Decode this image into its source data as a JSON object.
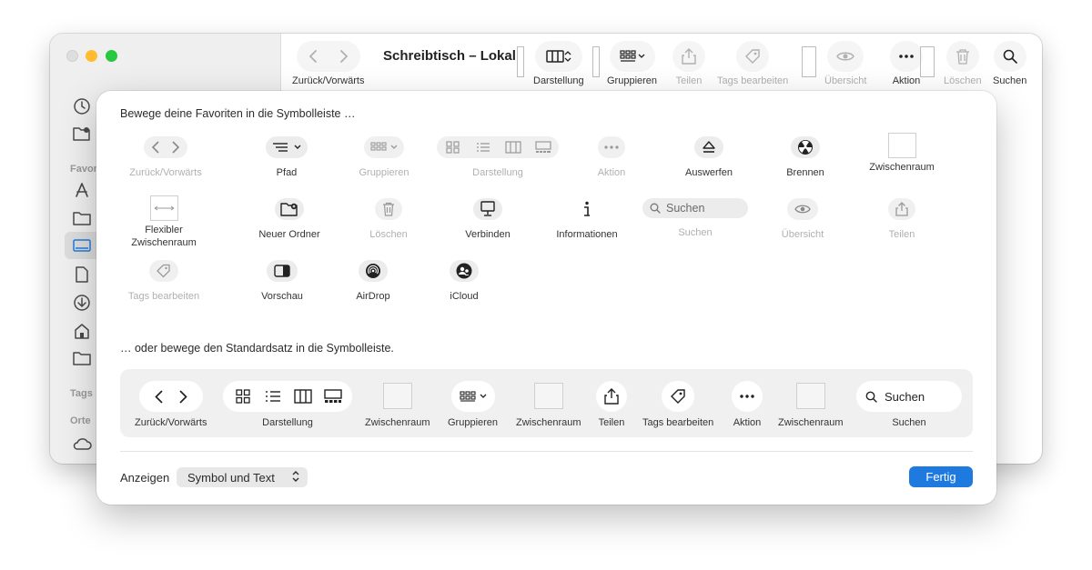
{
  "finder": {
    "title": "Schreibtisch – Lokal",
    "sidebar": {
      "favorites_label": "Favor",
      "tags_label": "Tags",
      "places_label": "Orte"
    },
    "toolbar": {
      "back_forward": "Zurück/Vorwärts",
      "view": "Darstellung",
      "group": "Gruppieren",
      "share": "Teilen",
      "edit_tags": "Tags bearbeiten",
      "quicklook": "Übersicht",
      "action": "Aktion",
      "delete": "Löschen",
      "search": "Suchen"
    }
  },
  "sheet": {
    "heading_favorites": "Bewege deine Favoriten in die Symbolleiste …",
    "heading_default": "… oder bewege den Standardsatz in die Symbolleiste.",
    "palette": {
      "back_forward": "Zurück/Vorwärts",
      "path": "Pfad",
      "group": "Gruppieren",
      "view": "Darstellung",
      "action": "Aktion",
      "eject": "Auswerfen",
      "burn": "Brennen",
      "space": "Zwischenraum",
      "flexible_space": "Flexibler Zwischenraum",
      "new_folder": "Neuer Ordner",
      "delete": "Löschen",
      "connect": "Verbinden",
      "get_info": "Informationen",
      "search_placeholder": "Suchen",
      "search": "Suchen",
      "quicklook": "Übersicht",
      "share": "Teilen",
      "edit_tags": "Tags bearbeiten",
      "preview": "Vorschau",
      "airdrop": "AirDrop",
      "icloud": "iCloud"
    },
    "default_set": {
      "back_forward": "Zurück/Vorwärts",
      "view": "Darstellung",
      "space1": "Zwischenraum",
      "group": "Gruppieren",
      "space2": "Zwischenraum",
      "share": "Teilen",
      "edit_tags": "Tags bearbeiten",
      "action": "Aktion",
      "space3": "Zwischenraum",
      "search_text": "Suchen",
      "search": "Suchen"
    },
    "show_label": "Anzeigen",
    "show_value": "Symbol und Text",
    "done": "Fertig"
  }
}
